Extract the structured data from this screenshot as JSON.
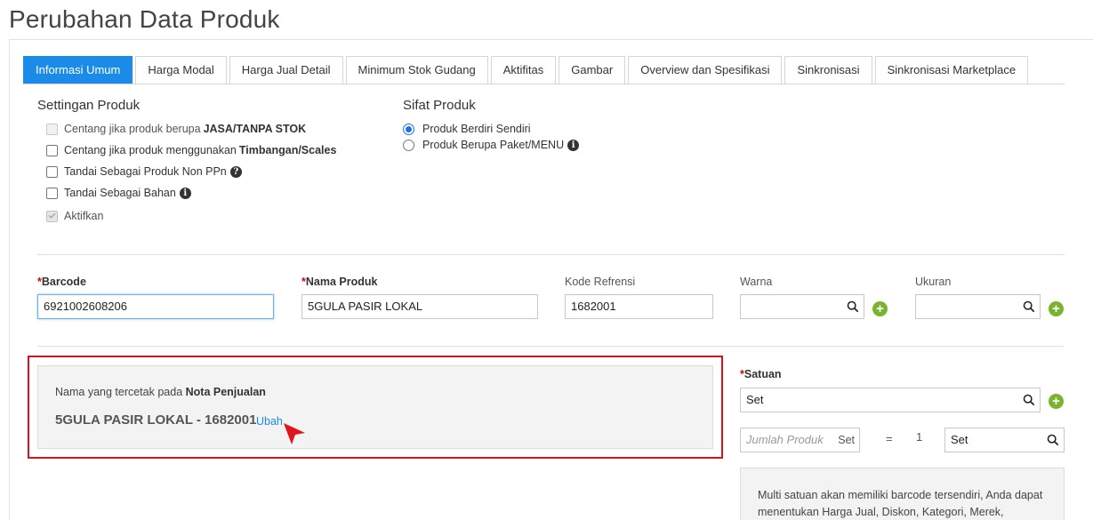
{
  "page": {
    "title": "Perubahan Data Produk"
  },
  "tabs": [
    {
      "label": "Informasi Umum",
      "active": true
    },
    {
      "label": "Harga Modal"
    },
    {
      "label": "Harga Jual Detail"
    },
    {
      "label": "Minimum Stok Gudang"
    },
    {
      "label": "Aktifitas"
    },
    {
      "label": "Gambar"
    },
    {
      "label": "Overview dan Spesifikasi"
    },
    {
      "label": "Sinkronisasi"
    },
    {
      "label": "Sinkronisasi Marketplace"
    }
  ],
  "settingan": {
    "title": "Settingan Produk",
    "options": [
      {
        "prefix": "Centang jika produk berupa",
        "bold": "JASA/TANPA STOK",
        "checked": false,
        "disabled": true
      },
      {
        "prefix": "Centang jika produk menggunakan",
        "bold": "Timbangan/Scales",
        "checked": false
      },
      {
        "prefix": "Tandai Sebagai Produk Non PPn",
        "bold": "",
        "icon": "question-circle-icon"
      },
      {
        "prefix": "Tandai Sebagai Bahan",
        "bold": "",
        "icon": "info-circle-icon"
      },
      {
        "prefix": "Aktifkan",
        "bold": "",
        "checked": true,
        "disabled": true
      }
    ]
  },
  "sifat": {
    "title": "Sifat Produk",
    "options": [
      {
        "label": "Produk Berdiri Sendiri",
        "checked": true
      },
      {
        "label": "Produk Berupa Paket/MENU",
        "icon": "info-circle-icon"
      }
    ]
  },
  "fields": {
    "barcode": {
      "star": "*",
      "label": "Barcode",
      "value": "6921002608206"
    },
    "nama_produk": {
      "star": "*",
      "label": "Nama Produk",
      "value": "5GULA PASIR LOKAL"
    },
    "kode_refrensi": {
      "label": "Kode Refrensi",
      "value": "1682001"
    },
    "warna": {
      "label": "Warna",
      "value": ""
    },
    "ukuran": {
      "label": "Ukuran",
      "value": ""
    }
  },
  "nota": {
    "label_prefix": "Nama yang tercetak pada",
    "label_bold": "Nota Penjualan",
    "name": "5GULA PASIR LOKAL - 1682001",
    "link": "Ubah"
  },
  "satuan": {
    "star": "*",
    "label": "Satuan",
    "value": "Set",
    "jumlah_placeholder": "Jumlah Produk",
    "jumlah_suffix": "Set",
    "equals": "=",
    "qty": "1",
    "target_value": "Set",
    "multi_text": "Multi satuan akan memiliki barcode tersendiri, Anda dapat menentukan Harga Jual, Diskon, Kategori, Merek,"
  },
  "colors": {
    "accent": "#1a8be8",
    "highlight": "#d9131a",
    "add": "#7ab32e"
  }
}
